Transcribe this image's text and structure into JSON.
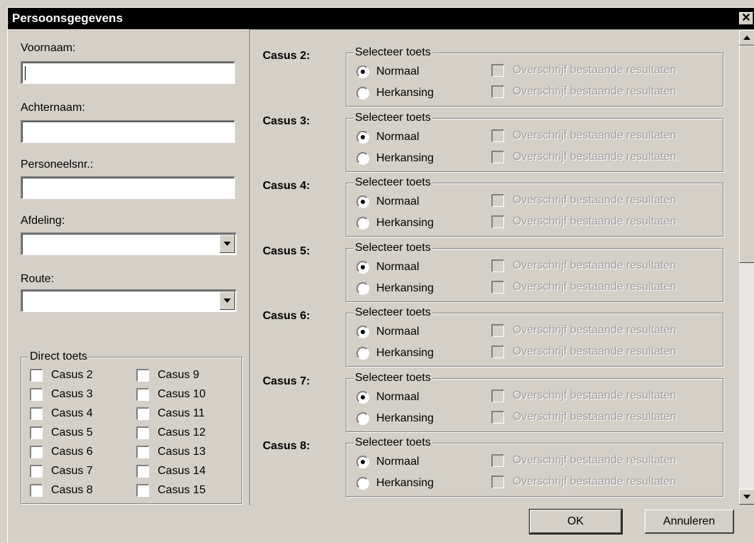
{
  "window": {
    "title": "Persoonsgegevens",
    "close_glyph": "✕"
  },
  "fields": {
    "voornaam": {
      "label": "Voornaam:",
      "value": ""
    },
    "achternaam": {
      "label": "Achternaam:",
      "value": ""
    },
    "personeelsnr": {
      "label": "Personeelsnr.:",
      "value": ""
    },
    "afdeling": {
      "label": "Afdeling:",
      "selected": ""
    },
    "route": {
      "label": "Route:",
      "selected": ""
    }
  },
  "direct_toets": {
    "title": "Direct toets",
    "items": [
      {
        "label": "Casus 2",
        "checked": false
      },
      {
        "label": "Casus 3",
        "checked": false
      },
      {
        "label": "Casus 4",
        "checked": false
      },
      {
        "label": "Casus 5",
        "checked": false
      },
      {
        "label": "Casus 6",
        "checked": false
      },
      {
        "label": "Casus 7",
        "checked": false
      },
      {
        "label": "Casus 8",
        "checked": false
      },
      {
        "label": "Casus 9",
        "checked": false
      },
      {
        "label": "Casus 10",
        "checked": false
      },
      {
        "label": "Casus 11",
        "checked": false
      },
      {
        "label": "Casus 12",
        "checked": false
      },
      {
        "label": "Casus 13",
        "checked": false
      },
      {
        "label": "Casus 14",
        "checked": false
      },
      {
        "label": "Casus 15",
        "checked": false
      }
    ]
  },
  "casus_sections": [
    {
      "label": "Casus 2:",
      "group_title": "Selecteer toets",
      "normaal": "Normaal",
      "herkansing": "Herkansing",
      "overwrite": "Overschrijf bestaande resultaten",
      "selected": "normaal"
    },
    {
      "label": "Casus 3:",
      "group_title": "Selecteer toets",
      "normaal": "Normaal",
      "herkansing": "Herkansing",
      "overwrite": "Overschrijf bestaande resultaten",
      "selected": "normaal"
    },
    {
      "label": "Casus 4:",
      "group_title": "Selecteer toets",
      "normaal": "Normaal",
      "herkansing": "Herkansing",
      "overwrite": "Overschrijf bestaande resultaten",
      "selected": "normaal"
    },
    {
      "label": "Casus 5:",
      "group_title": "Selecteer toets",
      "normaal": "Normaal",
      "herkansing": "Herkansing",
      "overwrite": "Overschrijf bestaande resultaten",
      "selected": "normaal"
    },
    {
      "label": "Casus 6:",
      "group_title": "Selecteer toets",
      "normaal": "Normaal",
      "herkansing": "Herkansing",
      "overwrite": "Overschrijf bestaande resultaten",
      "selected": "normaal"
    },
    {
      "label": "Casus 7:",
      "group_title": "Selecteer toets",
      "normaal": "Normaal",
      "herkansing": "Herkansing",
      "overwrite": "Overschrijf bestaande resultaten",
      "selected": "normaal"
    },
    {
      "label": "Casus 8:",
      "group_title": "Selecteer toets",
      "normaal": "Normaal",
      "herkansing": "Herkansing",
      "overwrite": "Overschrijf bestaande resultaten",
      "selected": "normaal"
    }
  ],
  "buttons": {
    "ok": "OK",
    "cancel": "Annuleren"
  }
}
